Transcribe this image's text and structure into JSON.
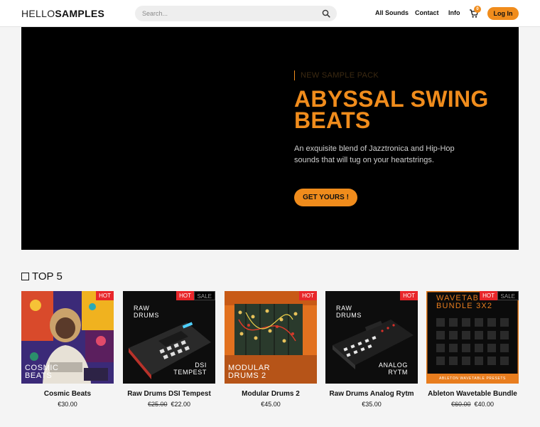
{
  "header": {
    "logo_left": "HELLO",
    "logo_right": "SAMPLES",
    "search_placeholder": "Search...",
    "nav": [
      "All Sounds",
      "Contact",
      "Info"
    ],
    "cart_count": "0",
    "login_label": "Log In"
  },
  "hero": {
    "eyebrow": "NEW SAMPLE PACK",
    "title": "ABYSSAL SWING BEATS",
    "description": "An exquisite blend of Jazztronica and Hip-Hop sounds that will tug on your heartstrings.",
    "cta": "GET YOURS !"
  },
  "colors": {
    "accent": "#f08c1c",
    "hot": "#e8262a",
    "hero_bg": "#000000"
  },
  "top5": {
    "title": "TOP 5",
    "products": [
      {
        "name": "Cosmic Beats",
        "price": "€30.00",
        "old_price": "",
        "hot": "HOT",
        "sale": "",
        "cover_text": "COSMIC\nBEATS"
      },
      {
        "name": "Raw Drums DSI Tempest",
        "price": "€22.00",
        "old_price": "€25.00",
        "hot": "HOT",
        "sale": "SALE",
        "cover_top": "RAW\nDRUMS",
        "cover_bottom": "DSI\nTEMPEST"
      },
      {
        "name": "Modular Drums 2",
        "price": "€45.00",
        "old_price": "",
        "hot": "HOT",
        "sale": "",
        "cover_text": "MODULAR\nDRUMS 2"
      },
      {
        "name": "Raw Drums Analog Rytm",
        "price": "€35.00",
        "old_price": "",
        "hot": "HOT",
        "sale": "",
        "cover_top": "RAW\nDRUMS",
        "cover_bottom": "ANALOG\nRYTM"
      },
      {
        "name": "Ableton Wavetable Bundle",
        "price": "€40.00",
        "old_price": "€60.00",
        "hot": "HOT",
        "sale": "SALE",
        "cover_text": "WAVETABLE\nBUNDLE 3X2",
        "cover_caption": "ABLETON WAVETABLE PRESETS"
      }
    ]
  }
}
